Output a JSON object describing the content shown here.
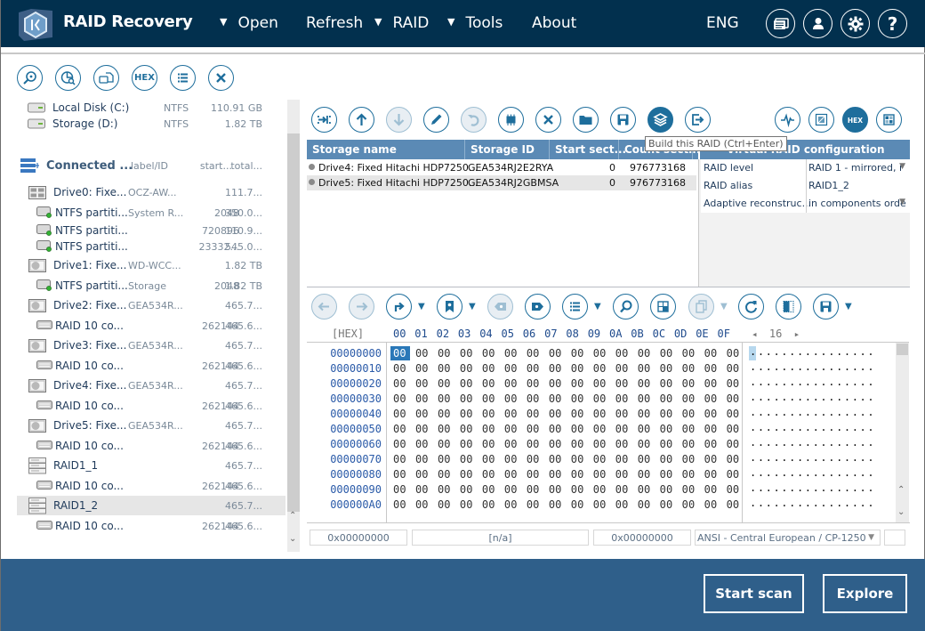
{
  "app": {
    "title": "RAID Recovery"
  },
  "menu": {
    "items": [
      {
        "label": "Open",
        "dropdown": true
      },
      {
        "label": "Refresh",
        "dropdown": false
      },
      {
        "label": "RAID",
        "dropdown": true
      },
      {
        "label": "Tools",
        "dropdown": true
      },
      {
        "label": "About",
        "dropdown": false
      }
    ],
    "language": "ENG",
    "icons": [
      "messages-icon",
      "user-icon",
      "settings-gear-icon",
      "help-icon"
    ]
  },
  "left_toolbar": {
    "buttons": [
      "search-scan-icon",
      "partition-search-icon",
      "open-image-icon",
      "hex-view-icon",
      "list-view-icon",
      "close-icon"
    ],
    "hex_label": "HEX"
  },
  "tree": {
    "local_disks": [
      {
        "name": "Local Disk (C:)",
        "fs": "NTFS",
        "size": "110.91 GB"
      },
      {
        "name": "Storage (D:)",
        "fs": "NTFS",
        "size": "1.82 TB"
      }
    ],
    "connected_header": {
      "name": "Connected ...",
      "label_col": "label/ID",
      "start_col": "start...",
      "total_col": "total..."
    },
    "rows": [
      {
        "type": "drive-ssd",
        "indent": 0,
        "name": "Drive0: Fixe...",
        "label": "OCZ-AW...",
        "start": "",
        "total": "111.7..."
      },
      {
        "type": "partition",
        "indent": 1,
        "name": "NTFS partiti...",
        "label": "System R...",
        "start": "2048",
        "total": "350.0..."
      },
      {
        "type": "partition",
        "indent": 1,
        "name": "NTFS partiti...",
        "label": "",
        "start": "720896",
        "total": "110.9..."
      },
      {
        "type": "partition",
        "indent": 1,
        "name": "NTFS partiti...",
        "label": "",
        "start": "23332...",
        "total": "545.0..."
      },
      {
        "type": "drive-hdd",
        "indent": 0,
        "name": "Drive1: Fixe...",
        "label": "WD-WCC...",
        "start": "",
        "total": "1.82 TB"
      },
      {
        "type": "partition",
        "indent": 1,
        "name": "NTFS partiti...",
        "label": "Storage",
        "start": "2048",
        "total": "1.82 TB"
      },
      {
        "type": "drive-hdd",
        "indent": 0,
        "name": "Drive2: Fixe...",
        "label": "GEA534R...",
        "start": "",
        "total": "465.7..."
      },
      {
        "type": "raid-comp",
        "indent": 1,
        "name": "RAID 10 co...",
        "label": "",
        "start": "262144",
        "total": "465.6..."
      },
      {
        "type": "drive-hdd",
        "indent": 0,
        "name": "Drive3: Fixe...",
        "label": "GEA534R...",
        "start": "",
        "total": "465.7..."
      },
      {
        "type": "raid-comp",
        "indent": 1,
        "name": "RAID 10 co...",
        "label": "",
        "start": "262144",
        "total": "465.6..."
      },
      {
        "type": "drive-hdd",
        "indent": 0,
        "name": "Drive4: Fixe...",
        "label": "GEA534R...",
        "start": "",
        "total": "465.7..."
      },
      {
        "type": "raid-comp",
        "indent": 1,
        "name": "RAID 10 co...",
        "label": "",
        "start": "262144",
        "total": "465.6..."
      },
      {
        "type": "drive-hdd",
        "indent": 0,
        "name": "Drive5: Fixe...",
        "label": "GEA534R...",
        "start": "",
        "total": "465.7..."
      },
      {
        "type": "raid-comp",
        "indent": 1,
        "name": "RAID 10 co...",
        "label": "",
        "start": "262144",
        "total": "465.6..."
      },
      {
        "type": "raid",
        "indent": 0,
        "name": "RAID1_1",
        "label": "",
        "start": "",
        "total": "465.7..."
      },
      {
        "type": "raid-comp",
        "indent": 1,
        "name": "RAID 10 co...",
        "label": "",
        "start": "262144",
        "total": "465.6..."
      },
      {
        "type": "raid",
        "indent": 0,
        "name": "RAID1_2",
        "label": "",
        "start": "",
        "total": "465.7...",
        "selected": true
      },
      {
        "type": "raid-comp",
        "indent": 1,
        "name": "RAID 10 co...",
        "label": "",
        "start": "262144",
        "total": "465.6..."
      }
    ]
  },
  "raid_toolbar": {
    "buttons": [
      {
        "name": "add-component-icon",
        "disabled": false
      },
      {
        "name": "move-up-icon",
        "disabled": false
      },
      {
        "name": "move-down-icon",
        "disabled": true
      },
      {
        "name": "edit-icon",
        "disabled": false
      },
      {
        "name": "undo-icon",
        "disabled": true
      },
      {
        "name": "chip-icon",
        "disabled": false
      },
      {
        "name": "remove-icon",
        "disabled": false
      },
      {
        "name": "open-folder-icon",
        "disabled": false
      },
      {
        "name": "save-icon",
        "disabled": false
      },
      {
        "name": "build-raid-icon",
        "disabled": false,
        "active": true
      },
      {
        "name": "export-icon",
        "disabled": false
      }
    ],
    "right_buttons": [
      "signal-icon",
      "chart-icon",
      "hex-icon",
      "map-icon"
    ],
    "tooltip": "Build this RAID (Ctrl+Enter)"
  },
  "storage_table": {
    "headers": [
      "Storage name",
      "Storage ID",
      "Start sect...",
      "Count secti..."
    ],
    "rows": [
      {
        "name": "Drive4: Fixed Hitachi HDP7250...",
        "id": "GEA534RJ2E2RYA",
        "start": "0",
        "count": "976773168"
      },
      {
        "name": "Drive5: Fixed Hitachi HDP7250...",
        "id": "GEA534RJ2GBMSA",
        "start": "0",
        "count": "976773168",
        "selected": true
      }
    ]
  },
  "raid_config": {
    "title": "Virtual RAID configuration",
    "rows": [
      {
        "key": "RAID level",
        "value": "RAID 1 - mirrored, r",
        "dropdown": true
      },
      {
        "key": "RAID alias",
        "value": "RAID1_2",
        "dropdown": false
      },
      {
        "key": "Adaptive reconstruc...",
        "value": "in components orde",
        "dropdown": true
      }
    ]
  },
  "hex_toolbar": {
    "buttons": [
      "back-icon",
      "forward-icon",
      "goto-icon",
      "bookmark-icon",
      "prev-bookmark-icon",
      "next-bookmark-icon",
      "list-icon",
      "find-icon",
      "select-block-icon",
      "copy-icon",
      "refresh-icon",
      "panel-icon",
      "save-icon"
    ]
  },
  "hex_view": {
    "label": "[HEX]",
    "columns": [
      "00",
      "01",
      "02",
      "03",
      "04",
      "05",
      "06",
      "07",
      "08",
      "09",
      "0A",
      "0B",
      "0C",
      "0D",
      "0E",
      "0F"
    ],
    "bytes_per_row": "16",
    "addresses": [
      "00000000",
      "00000010",
      "00000020",
      "00000030",
      "00000040",
      "00000050",
      "00000060",
      "00000070",
      "00000080",
      "00000090",
      "000000A0"
    ],
    "row_bytes": "00 00 00 00 00 00 00 00 00 00 00 00 00 00 00 00",
    "row_ascii": "................",
    "cursor_offset": "00"
  },
  "status_bar": {
    "offset": "0x00000000",
    "value": "[n/a]",
    "selection": "0x00000000",
    "encoding": "ANSI - Central European / CP-1250"
  },
  "footer": {
    "start_scan": "Start scan",
    "explore": "Explore"
  },
  "colors": {
    "topbar": "#02304e",
    "accent": "#1e6e9c",
    "table_header": "#5b8ab5",
    "footer": "#2f5f8a"
  }
}
